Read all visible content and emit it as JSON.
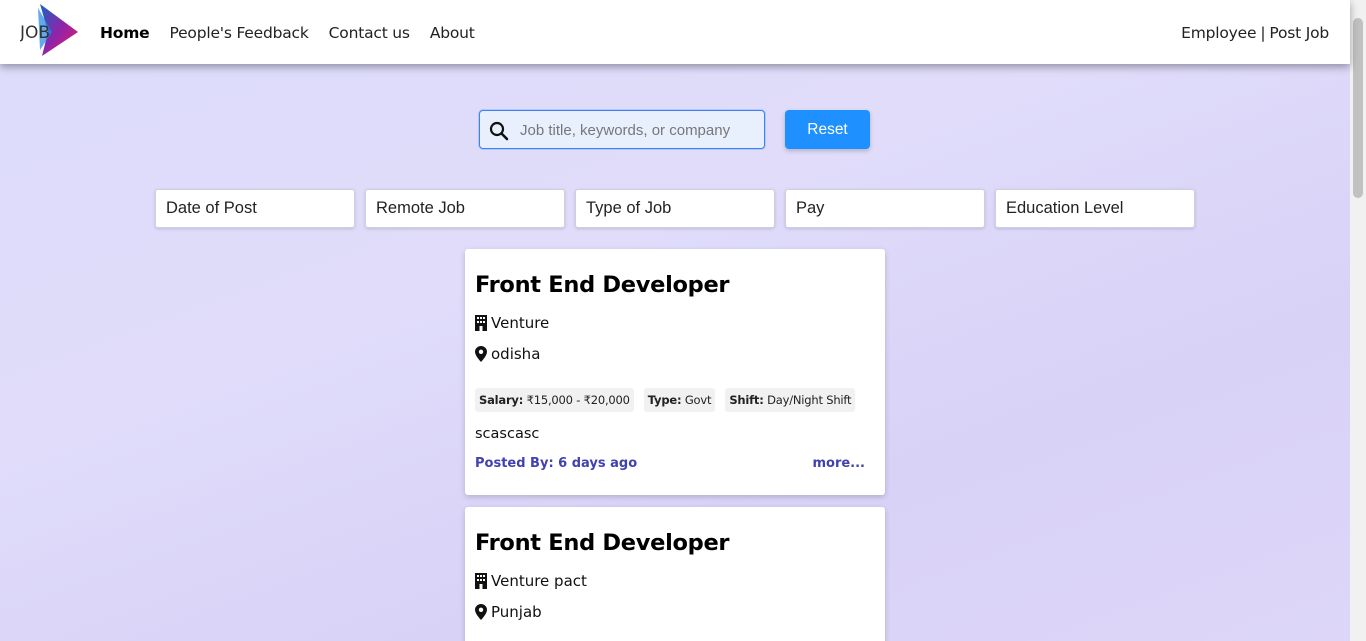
{
  "nav": {
    "logo_text": "JOB",
    "links": [
      {
        "label": "Home",
        "active": true
      },
      {
        "label": "People's Feedback",
        "active": false
      },
      {
        "label": "Contact us",
        "active": false
      },
      {
        "label": "About",
        "active": false
      }
    ],
    "right": {
      "employee": "Employee",
      "separator": "|",
      "post_job": "Post Job"
    }
  },
  "search": {
    "placeholder": "Job title, keywords, or company",
    "value": "",
    "reset_label": "Reset"
  },
  "filters": [
    "Date of Post",
    "Remote Job",
    "Type of Job",
    "Pay",
    "Education Level"
  ],
  "jobs": [
    {
      "title": "Front End Developer",
      "company": "Venture",
      "location": "odisha",
      "salary_label": "Salary:",
      "salary": "₹15,000 - ₹20,000",
      "type_label": "Type:",
      "type": "Govt",
      "shift_label": "Shift:",
      "shift": "Day/Night Shift",
      "description": "scascasc",
      "posted": "Posted By: 6 days ago",
      "more": "more..."
    },
    {
      "title": "Front End Developer",
      "company": "Venture pact",
      "location": "Punjab"
    }
  ],
  "colors": {
    "accent": "#1e90ff",
    "link": "#4141b0",
    "logo_blue": "#1565c0",
    "logo_pink": "#e91e63"
  }
}
